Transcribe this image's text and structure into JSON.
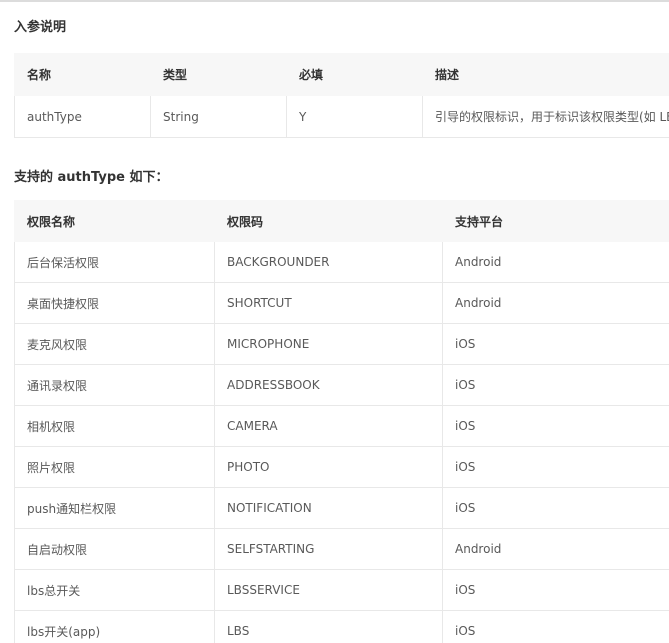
{
  "section1": {
    "title": "入参说明",
    "columns": [
      "名称",
      "类型",
      "必填",
      "描述"
    ],
    "rows": [
      [
        "authType",
        "String",
        "Y",
        "引导的权限标识，用于标识该权限类型(如 LB"
      ]
    ]
  },
  "section2": {
    "title": "支持的 authType 如下：",
    "columns": [
      "权限名称",
      "权限码",
      "支持平台"
    ],
    "rows": [
      [
        "后台保活权限",
        "BACKGROUNDER",
        "Android"
      ],
      [
        "桌面快捷权限",
        "SHORTCUT",
        "Android"
      ],
      [
        "麦克风权限",
        "MICROPHONE",
        "iOS"
      ],
      [
        "通讯录权限",
        "ADDRESSBOOK",
        "iOS"
      ],
      [
        "相机权限",
        "CAMERA",
        "iOS"
      ],
      [
        "照片权限",
        "PHOTO",
        "iOS"
      ],
      [
        "push通知栏权限",
        "NOTIFICATION",
        "iOS"
      ],
      [
        "自启动权限",
        "SELFSTARTING",
        "Android"
      ],
      [
        "lbs总开关",
        "LBSSERVICE",
        "iOS"
      ],
      [
        "lbs开关(app)",
        "LBS",
        "iOS"
      ]
    ]
  }
}
